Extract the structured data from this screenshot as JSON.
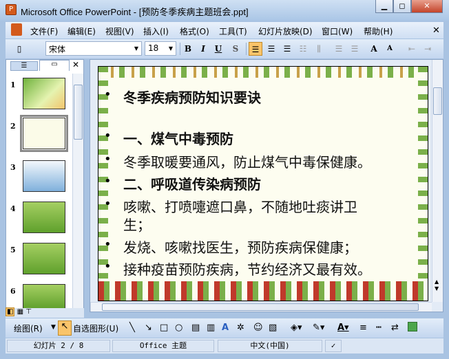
{
  "window": {
    "title": "Microsoft Office PowerPoint - [预防冬季疾病主题班会.ppt]"
  },
  "menu": [
    "文件(F)",
    "编辑(E)",
    "视图(V)",
    "插入(I)",
    "格式(O)",
    "工具(T)",
    "幻灯片放映(D)",
    "窗口(W)",
    "帮助(H)"
  ],
  "toolbar": {
    "font": "宋体",
    "size": "18",
    "bold": "B",
    "italic": "I",
    "underline": "U",
    "shadow": "S"
  },
  "slides_panel": {
    "numbers": [
      "1",
      "2",
      "3",
      "4",
      "5",
      "6"
    ],
    "selected": 2
  },
  "slide": {
    "lines": [
      {
        "text": "冬季疾病预防知识要诀",
        "bold": true
      },
      {
        "text": "一、煤气中毒预防",
        "bold": true
      },
      {
        "text": "冬季取暖要通风，防止煤气中毒保健康。",
        "bold": false
      },
      {
        "text": "二、呼吸道传染病预防",
        "bold": true
      },
      {
        "text": "咳嗽、打喷嚏遮口鼻，不随地吐痰讲卫",
        "bold": false
      },
      {
        "text": "生；",
        "bold": false
      },
      {
        "text": "发烧、咳嗽找医生，预防疾病保健康；",
        "bold": false
      },
      {
        "text": "接种疫苗预防疾病，节约经济又最有效。",
        "bold": false
      }
    ]
  },
  "drawbar": {
    "draw": "绘图(R)",
    "autoshapes": "自选图形(U)"
  },
  "status": {
    "slide": "幻灯片 2 / 8",
    "theme": "Office 主题",
    "lang": "中文(中国)"
  },
  "colors": {
    "accent": "#f9c46a",
    "frame": "#a9c3e2"
  }
}
